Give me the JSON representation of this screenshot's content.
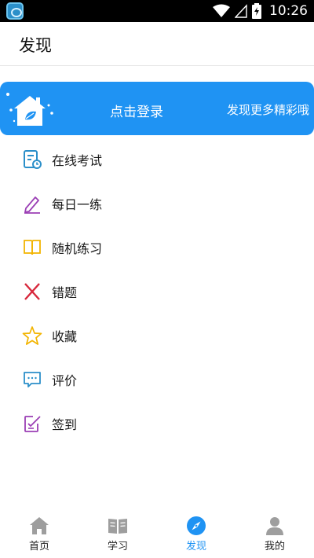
{
  "status_bar": {
    "time": "10:26"
  },
  "header": {
    "title": "发现"
  },
  "banner": {
    "login_label": "点击登录",
    "slogan": "发现更多精彩哦",
    "color": "#1f93f3"
  },
  "menu": {
    "items": [
      {
        "label": "在线考试",
        "icon": "exam-icon",
        "color": "#2b8fc9"
      },
      {
        "label": "每日一练",
        "icon": "pencil-icon",
        "color": "#9b3fb5"
      },
      {
        "label": "随机练习",
        "icon": "book-icon",
        "color": "#f2b400"
      },
      {
        "label": "错题",
        "icon": "cross-icon",
        "color": "#d8283c"
      },
      {
        "label": "收藏",
        "icon": "star-icon",
        "color": "#f2b400"
      },
      {
        "label": "评价",
        "icon": "comment-icon",
        "color": "#2b8fc9"
      },
      {
        "label": "签到",
        "icon": "checkin-icon",
        "color": "#9b3fb5"
      }
    ]
  },
  "bottom_nav": {
    "tabs": [
      {
        "label": "首页",
        "icon": "home-icon"
      },
      {
        "label": "学习",
        "icon": "book-open-icon"
      },
      {
        "label": "发现",
        "icon": "compass-icon",
        "active": true
      },
      {
        "label": "我的",
        "icon": "user-icon"
      }
    ],
    "active_color": "#1f93f3",
    "inactive_icon_color": "#9e9e9e"
  }
}
